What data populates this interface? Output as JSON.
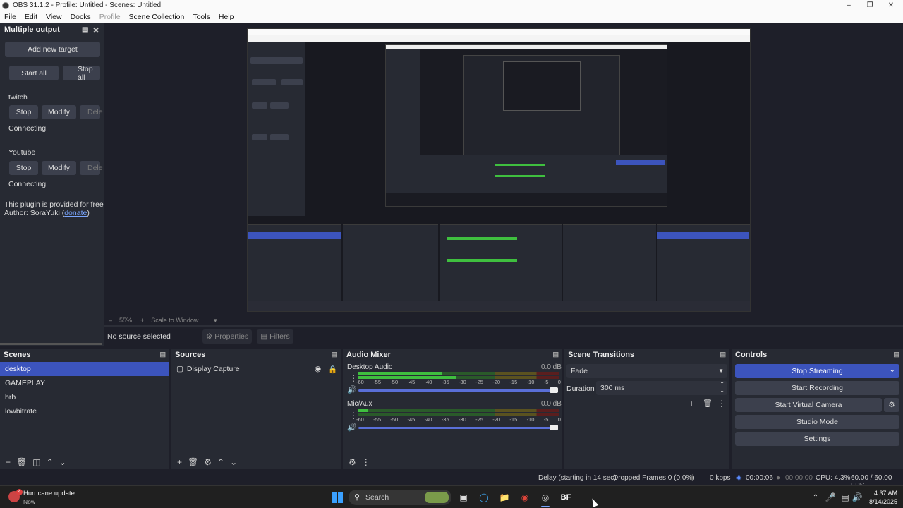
{
  "window": {
    "title": "OBS 31.1.2 - Profile: Untitled - Scenes: Untitled"
  },
  "menu": {
    "file": "File",
    "edit": "Edit",
    "view": "View",
    "docks": "Docks",
    "profile": "Profile",
    "scene_collection": "Scene Collection",
    "tools": "Tools",
    "help": "Help"
  },
  "multiple_output": {
    "title": "Multiple output",
    "add_target": "Add new target",
    "start_all": "Start all",
    "stop_all": "Stop all",
    "targets": [
      {
        "name": "twitch",
        "stop": "Stop",
        "modify": "Modify",
        "delete": "Dele",
        "status": "Connecting"
      },
      {
        "name": "Youtube",
        "stop": "Stop",
        "modify": "Modify",
        "delete": "Dele",
        "status": "Connecting"
      }
    ],
    "info_line1": "This plugin is provided for free.",
    "info_author": "Author: SoraYuki (",
    "info_link": "donate",
    "info_close": ")"
  },
  "preview": {
    "zoom": "55%",
    "scale_mode": "Scale to Window"
  },
  "source_bar": {
    "no_source": "No source selected",
    "properties": "Properties",
    "filters": "Filters"
  },
  "scenes": {
    "title": "Scenes",
    "items": [
      "desktop",
      "GAMEPLAY",
      "brb",
      "lowbitrate"
    ]
  },
  "sources": {
    "title": "Sources",
    "items": [
      "Display Capture"
    ]
  },
  "audio_mixer": {
    "title": "Audio Mixer",
    "channels": [
      {
        "name": "Desktop Audio",
        "db": "0.0 dB"
      },
      {
        "name": "Mic/Aux",
        "db": "0.0 dB"
      }
    ],
    "ticks": [
      "-60",
      "-55",
      "-50",
      "-45",
      "-40",
      "-35",
      "-30",
      "-25",
      "-20",
      "-15",
      "-10",
      "-5",
      "0"
    ]
  },
  "scene_transitions": {
    "title": "Scene Transitions",
    "transition": "Fade",
    "duration_label": "Duration",
    "duration_value": "300 ms"
  },
  "controls": {
    "title": "Controls",
    "stop_streaming": "Stop Streaming",
    "start_recording": "Start Recording",
    "start_virtual_camera": "Start Virtual Camera",
    "studio_mode": "Studio Mode",
    "settings": "Settings"
  },
  "status": {
    "delay": "Delay (starting in 14 sec)",
    "dropped": "Dropped Frames 0 (0.0%)",
    "kbps": "0 kbps",
    "stream_time": "00:00:06",
    "rec_time": "00:00:00",
    "cpu": "CPU: 4.3%",
    "fps": "60.00 / 60.00 FPS"
  },
  "taskbar": {
    "notif_title": "Hurricane update",
    "notif_sub": "Now",
    "notif_badge": "4",
    "search": "Search",
    "time": "4:37 AM",
    "date": "8/14/2025"
  },
  "colors": {
    "accent": "#3c54bd",
    "meter_green": "#3fbf3f",
    "meter_yellow": "#b4a82a",
    "meter_red": "#b82a2a"
  }
}
